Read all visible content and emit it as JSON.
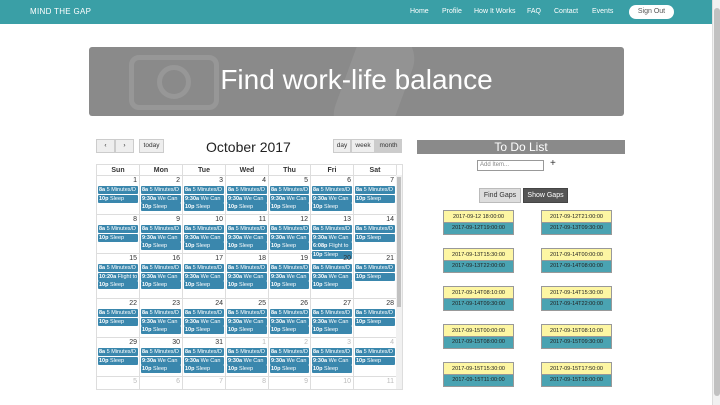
{
  "nav": {
    "brand": "MIND THE GAP",
    "items": [
      "Home",
      "Profile",
      "How It Works",
      "FAQ",
      "Contact",
      "Events"
    ],
    "signout": "Sign Out"
  },
  "hero": {
    "title": "Find work-life balance"
  },
  "calendar": {
    "prev_icon": "chevron-left-icon",
    "next_icon": "chevron-right-icon",
    "prev": "‹",
    "next": "›",
    "today": "today",
    "title": "October 2017",
    "views": [
      "day",
      "week",
      "month"
    ],
    "active_view": "month",
    "days_of_week": [
      "Sun",
      "Mon",
      "Tue",
      "Wed",
      "Thu",
      "Fri",
      "Sat"
    ],
    "weeks": [
      {
        "days": [
          {
            "num": "1",
            "events": [
              [
                "8a",
                "5 Minutes/D"
              ],
              [
                "10p",
                "Sleep"
              ]
            ]
          },
          {
            "num": "2",
            "events": [
              [
                "8a",
                "5 Minutes/D"
              ],
              [
                "9:30a",
                "We Can"
              ],
              [
                "10p",
                "Sleep"
              ]
            ]
          },
          {
            "num": "3",
            "events": [
              [
                "8a",
                "5 Minutes/D"
              ],
              [
                "9:30a",
                "We Can"
              ],
              [
                "10p",
                "Sleep"
              ]
            ]
          },
          {
            "num": "4",
            "events": [
              [
                "8a",
                "5 Minutes/D"
              ],
              [
                "9:30a",
                "We Can"
              ],
              [
                "10p",
                "Sleep"
              ]
            ]
          },
          {
            "num": "5",
            "events": [
              [
                "8a",
                "5 Minutes/D"
              ],
              [
                "9:30a",
                "We Can"
              ],
              [
                "10p",
                "Sleep"
              ]
            ]
          },
          {
            "num": "6",
            "events": [
              [
                "8a",
                "5 Minutes/D"
              ],
              [
                "9:30a",
                "We Can"
              ],
              [
                "10p",
                "Sleep"
              ]
            ]
          },
          {
            "num": "7",
            "events": [
              [
                "8a",
                "5 Minutes/D"
              ],
              [
                "10p",
                "Sleep"
              ]
            ]
          }
        ]
      },
      {
        "days": [
          {
            "num": "8",
            "events": [
              [
                "8a",
                "5 Minutes/D"
              ],
              [
                "10p",
                "Sleep"
              ]
            ]
          },
          {
            "num": "9",
            "events": [
              [
                "8a",
                "5 Minutes/D"
              ],
              [
                "9:30a",
                "We Can"
              ],
              [
                "10p",
                "Sleep"
              ]
            ]
          },
          {
            "num": "10",
            "events": [
              [
                "8a",
                "5 Minutes/D"
              ],
              [
                "9:30a",
                "We Can"
              ],
              [
                "10p",
                "Sleep"
              ]
            ]
          },
          {
            "num": "11",
            "events": [
              [
                "8a",
                "5 Minutes/D"
              ],
              [
                "9:30a",
                "We Can"
              ],
              [
                "10p",
                "Sleep"
              ]
            ]
          },
          {
            "num": "12",
            "events": [
              [
                "8a",
                "5 Minutes/D"
              ],
              [
                "9:30a",
                "We Can"
              ],
              [
                "10p",
                "Sleep"
              ]
            ]
          },
          {
            "num": "13",
            "events": [
              [
                "8a",
                "5 Minutes/D"
              ],
              [
                "9:30a",
                "We Can"
              ],
              [
                "6:08p",
                "Flight to"
              ],
              [
                "10p",
                "Sleep"
              ]
            ]
          },
          {
            "num": "14",
            "events": [
              [
                "8a",
                "5 Minutes/D"
              ],
              [
                "10p",
                "Sleep"
              ]
            ]
          }
        ]
      },
      {
        "days": [
          {
            "num": "15",
            "events": [
              [
                "8a",
                "5 Minutes/D"
              ],
              [
                "10:20a",
                "Flight to"
              ],
              [
                "10p",
                "Sleep"
              ]
            ]
          },
          {
            "num": "16",
            "events": [
              [
                "8a",
                "5 Minutes/D"
              ],
              [
                "9:30a",
                "We Can"
              ],
              [
                "10p",
                "Sleep"
              ]
            ]
          },
          {
            "num": "17",
            "events": [
              [
                "8a",
                "5 Minutes/D"
              ],
              [
                "9:30a",
                "We Can"
              ],
              [
                "10p",
                "Sleep"
              ]
            ]
          },
          {
            "num": "18",
            "events": [
              [
                "8a",
                "5 Minutes/D"
              ],
              [
                "9:30a",
                "We Can"
              ],
              [
                "10p",
                "Sleep"
              ]
            ]
          },
          {
            "num": "19",
            "events": [
              [
                "8a",
                "5 Minutes/D"
              ],
              [
                "9:30a",
                "We Can"
              ],
              [
                "10p",
                "Sleep"
              ]
            ]
          },
          {
            "num": "20",
            "events": [
              [
                "8a",
                "5 Minutes/D"
              ],
              [
                "9:30a",
                "We Can"
              ],
              [
                "10p",
                "Sleep"
              ]
            ]
          },
          {
            "num": "21",
            "events": [
              [
                "8a",
                "5 Minutes/D"
              ],
              [
                "10p",
                "Sleep"
              ]
            ]
          }
        ]
      },
      {
        "days": [
          {
            "num": "22",
            "events": [
              [
                "8a",
                "5 Minutes/D"
              ],
              [
                "10p",
                "Sleep"
              ]
            ]
          },
          {
            "num": "23",
            "events": [
              [
                "8a",
                "5 Minutes/D"
              ],
              [
                "9:30a",
                "We Can"
              ],
              [
                "10p",
                "Sleep"
              ]
            ]
          },
          {
            "num": "24",
            "events": [
              [
                "8a",
                "5 Minutes/D"
              ],
              [
                "9:30a",
                "We Can"
              ],
              [
                "10p",
                "Sleep"
              ]
            ]
          },
          {
            "num": "25",
            "events": [
              [
                "8a",
                "5 Minutes/D"
              ],
              [
                "9:30a",
                "We Can"
              ],
              [
                "10p",
                "Sleep"
              ]
            ]
          },
          {
            "num": "26",
            "events": [
              [
                "8a",
                "5 Minutes/D"
              ],
              [
                "9:30a",
                "We Can"
              ],
              [
                "10p",
                "Sleep"
              ]
            ]
          },
          {
            "num": "27",
            "events": [
              [
                "8a",
                "5 Minutes/D"
              ],
              [
                "9:30a",
                "We Can"
              ],
              [
                "10p",
                "Sleep"
              ]
            ]
          },
          {
            "num": "28",
            "events": [
              [
                "8a",
                "5 Minutes/D"
              ],
              [
                "10p",
                "Sleep"
              ]
            ]
          }
        ]
      },
      {
        "days": [
          {
            "num": "29",
            "events": [
              [
                "8a",
                "5 Minutes/D"
              ],
              [
                "10p",
                "Sleep"
              ]
            ]
          },
          {
            "num": "30",
            "events": [
              [
                "8a",
                "5 Minutes/D"
              ],
              [
                "9:30a",
                "We Can"
              ],
              [
                "10p",
                "Sleep"
              ]
            ]
          },
          {
            "num": "31",
            "events": [
              [
                "8a",
                "5 Minutes/D"
              ],
              [
                "9:30a",
                "We Can"
              ],
              [
                "10p",
                "Sleep"
              ]
            ]
          },
          {
            "num": "1",
            "other": true,
            "events": [
              [
                "8a",
                "5 Minutes/D"
              ],
              [
                "9:30a",
                "We Can"
              ],
              [
                "10p",
                "Sleep"
              ]
            ]
          },
          {
            "num": "2",
            "other": true,
            "events": [
              [
                "8a",
                "5 Minutes/D"
              ],
              [
                "9:30a",
                "We Can"
              ],
              [
                "10p",
                "Sleep"
              ]
            ]
          },
          {
            "num": "3",
            "other": true,
            "events": [
              [
                "8a",
                "5 Minutes/D"
              ],
              [
                "9:30a",
                "We Can"
              ],
              [
                "10p",
                "Sleep"
              ]
            ]
          },
          {
            "num": "4",
            "other": true,
            "events": [
              [
                "8a",
                "5 Minutes/D"
              ],
              [
                "10p",
                "Sleep"
              ]
            ]
          }
        ]
      },
      {
        "days": [
          {
            "num": "5",
            "other": true,
            "events": []
          },
          {
            "num": "6",
            "other": true,
            "events": []
          },
          {
            "num": "7",
            "other": true,
            "events": []
          },
          {
            "num": "8",
            "other": true,
            "events": []
          },
          {
            "num": "9",
            "other": true,
            "events": []
          },
          {
            "num": "10",
            "other": true,
            "events": []
          },
          {
            "num": "11",
            "other": true,
            "events": []
          }
        ]
      }
    ]
  },
  "todo": {
    "title": "To Do List",
    "add_placeholder": "Add Item...",
    "add_icon": "plus-icon",
    "add_glyph": "+",
    "find_gaps": "Find Gaps",
    "show_gaps": "Show Gaps",
    "gaps": [
      {
        "start": "2017-09-12 18:00:00",
        "end": "2017-09-12T19:00:00"
      },
      {
        "start": "2017-09-12T21:00:00",
        "end": "2017-09-13T09:30:00"
      },
      {
        "start": "2017-09-13T15:30:00",
        "end": "2017-09-13T22:00:00"
      },
      {
        "start": "2017-09-14T00:00:00",
        "end": "2017-09-14T08:00:00"
      },
      {
        "start": "2017-09-14T08:10:00",
        "end": "2017-09-14T09:30:00"
      },
      {
        "start": "2017-09-14T15:30:00",
        "end": "2017-09-14T22:00:00"
      },
      {
        "start": "2017-09-15T00:00:00",
        "end": "2017-09-15T08:00:00"
      },
      {
        "start": "2017-09-15T08:10:00",
        "end": "2017-09-15T09:30:00"
      },
      {
        "start": "2017-09-15T15:30:00",
        "end": "2017-09-15T11:00:00"
      },
      {
        "start": "2017-09-15T17:50:00",
        "end": "2017-09-15T18:00:00"
      }
    ]
  },
  "colors": {
    "nav": "#3a9fa6",
    "event": "#3a87ad",
    "gap_start": "#fdf6a3",
    "gap_end": "#4aa3b2"
  }
}
